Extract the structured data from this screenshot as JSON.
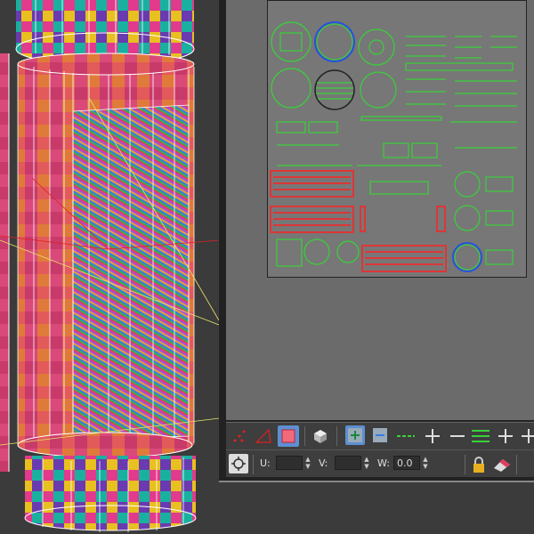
{
  "uv_editor": {
    "toolbar_bottom": {
      "u_label": "U:",
      "u_value": "",
      "v_label": "V:",
      "v_value": "",
      "w_label": "W:",
      "w_value": "0.0"
    },
    "tools": [
      "vertex-mode",
      "edge-mode",
      "face-mode",
      "element-mode",
      "freeform",
      "break",
      "weld",
      "align-horizontal",
      "align-vertical",
      "move",
      "stitch",
      "grow",
      "shrink"
    ]
  },
  "colors": {
    "viewport_bg": "#3b3b3b",
    "uv_bg": "#777777",
    "uv_island_green": "#39d13a",
    "uv_island_red": "#ff2020",
    "uv_island_blue": "#2850e0",
    "toolbar_active": "#5d8fd1",
    "wire_yellow": "#e6e66a",
    "wire_red": "#e02020"
  }
}
